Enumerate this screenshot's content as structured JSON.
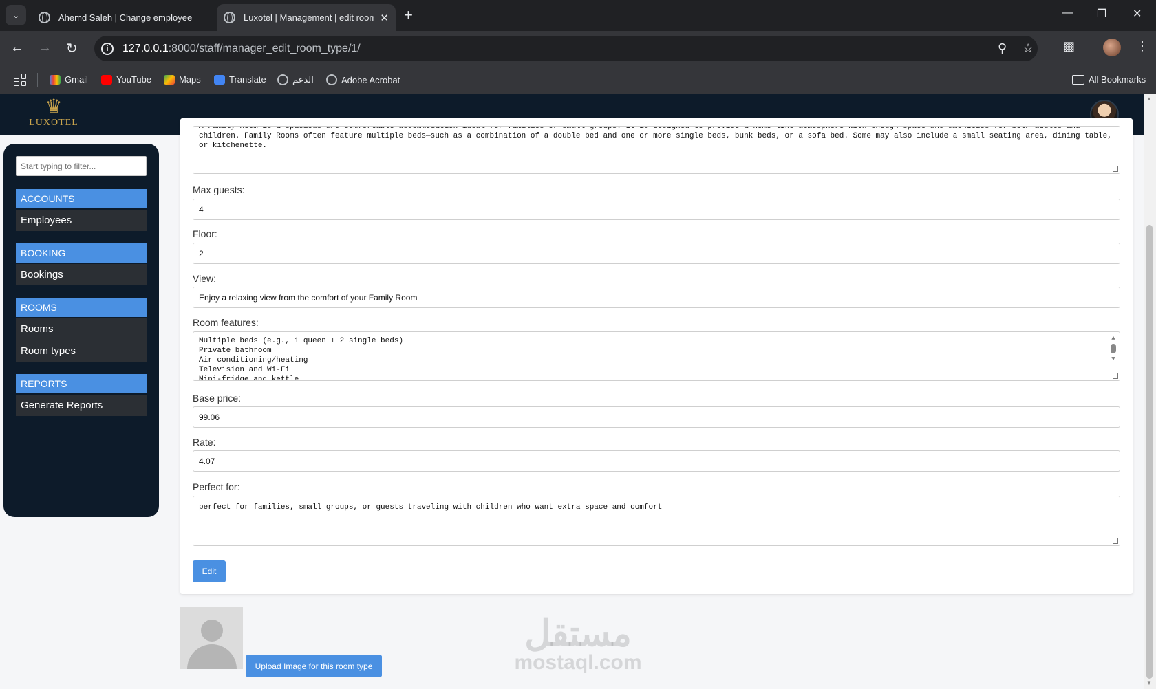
{
  "browser": {
    "tabs": [
      {
        "title": "Ahemd Saleh | Change employee"
      },
      {
        "title": "Luxotel | Management | edit room"
      }
    ],
    "url_host": "127.0.0.1",
    "url_path": ":8000/staff/manager_edit_room_type/1/",
    "bookmarks": [
      "Gmail",
      "YouTube",
      "Maps",
      "Translate",
      "الدعم",
      "Adobe Acrobat"
    ],
    "all_bookmarks": "All Bookmarks"
  },
  "brand": {
    "logo_text": "LUXOTEL"
  },
  "sidebar": {
    "filter_placeholder": "Start typing to filter...",
    "sections": [
      {
        "title": "ACCOUNTS",
        "items": [
          "Employees"
        ]
      },
      {
        "title": "BOOKING",
        "items": [
          "Bookings"
        ]
      },
      {
        "title": "ROOMS",
        "items": [
          "Rooms",
          "Room types"
        ]
      },
      {
        "title": "REPORTS",
        "items": [
          "Generate Reports"
        ]
      }
    ]
  },
  "form": {
    "description_value": "A Family Room is a spacious and comfortable accommodation ideal for families or small groups. It is designed to provide a home-like atmosphere with enough space and amenities for both adults and children. Family Rooms often feature multiple beds—such as a combination of a double bed and one or more single beds, bunk beds, or a sofa bed. Some may also include a small seating area, dining table, or kitchenette.",
    "max_guests_label": "Max guests:",
    "max_guests_value": "4",
    "floor_label": "Floor:",
    "floor_value": "2",
    "view_label": "View:",
    "view_value": "Enjoy a relaxing view from the comfort of your Family Room",
    "features_label": "Room features:",
    "features_value": "Multiple beds (e.g., 1 queen + 2 single beds)\nPrivate bathroom\nAir conditioning/heating\nTelevision and Wi-Fi\nMini-fridge and kettle",
    "base_price_label": "Base price:",
    "base_price_value": "99.06",
    "rate_label": "Rate:",
    "rate_value": "4.07",
    "perfect_for_label": "Perfect for:",
    "perfect_for_value": "perfect for families, small groups, or guests traveling with children who want extra space and comfort",
    "edit_button": "Edit"
  },
  "upload": {
    "button_label": "Upload Image for this room type"
  },
  "watermark": {
    "arabic": "مستقل",
    "latin": "mostaql.com"
  }
}
